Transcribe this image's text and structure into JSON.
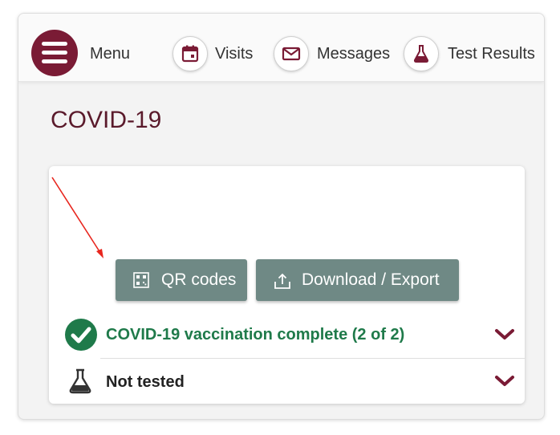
{
  "nav": {
    "menu_label": "Menu",
    "items": [
      {
        "label": "Visits",
        "icon": "calendar-icon"
      },
      {
        "label": "Messages",
        "icon": "envelope-icon"
      },
      {
        "label": "Test Results",
        "icon": "flask-icon"
      }
    ]
  },
  "page": {
    "title": "COVID-19"
  },
  "card": {
    "buttons": {
      "qr_label": "QR codes",
      "download_label": "Download / Export"
    },
    "rows": [
      {
        "label": "COVID-19 vaccination complete (2 of 2)",
        "icon": "check-circle-icon",
        "status_color": "#1f7a4a"
      },
      {
        "label": "Not tested",
        "icon": "flask-icon"
      }
    ]
  },
  "colors": {
    "brand": "#7a1b35",
    "title": "#5a1a2b",
    "button": "#6f8985",
    "success": "#1f7a4a"
  }
}
